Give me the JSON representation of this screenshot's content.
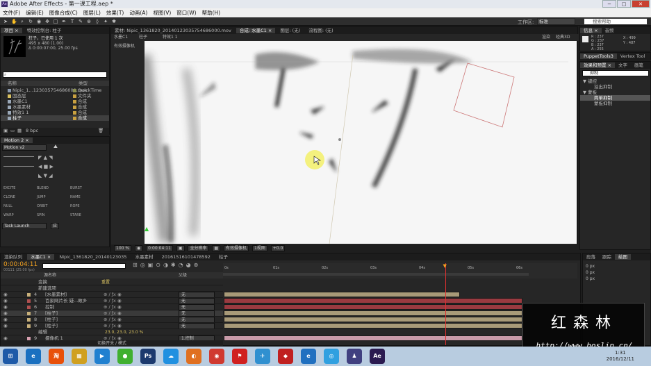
{
  "app": {
    "title": "Adobe After Effects - 第一课工程.aep *"
  },
  "window": {
    "minimize": "−",
    "maximize": "□",
    "close": "✕"
  },
  "menu": [
    "文件(F)",
    "编辑(E)",
    "图像合成(C)",
    "图层(L)",
    "效果(T)",
    "动画(A)",
    "视图(V)",
    "窗口(W)",
    "帮助(H)"
  ],
  "toolbar": {
    "workspace_label": "工作区:",
    "workspace_value": "标准",
    "search_placeholder": "搜索帮助"
  },
  "project": {
    "tabs": [
      "项目 ×",
      "特效控制台: 柱子"
    ],
    "preview_name": "柱子，已使用 1 次",
    "preview_size": "495 x 480 (1.00)",
    "preview_dur": "Δ 0:00:07:00, 25.00 fps",
    "col_name": "名称",
    "col_type": "类型",
    "items": [
      {
        "name": "Nipic_1...123035754686000.mov",
        "type": "QuickTime",
        "color": "#8a8f50"
      },
      {
        "name": "固态层",
        "type": "文件夹",
        "color": "#c8a040"
      },
      {
        "name": "水墨C1",
        "type": "合成",
        "color": "#c8a040"
      },
      {
        "name": "水墨素材",
        "type": "合成",
        "color": "#c8a040"
      },
      {
        "name": "特效1 1",
        "type": "合成",
        "color": "#c8a040"
      },
      {
        "name": "柱子",
        "type": "合成",
        "color": "#c8a040"
      }
    ],
    "bpc": "8 bpc"
  },
  "motion": {
    "tab": "Motion 2 ×",
    "preset": "Motion v2",
    "actions": [
      "EXCITE",
      "BLEND",
      "BURST",
      "CLONE",
      "JUMP",
      "NAME",
      "NULL",
      "ORBIT",
      "ROPE",
      "WARP",
      "SPIN",
      "STARE"
    ],
    "task": "Task Launch",
    "task_btn": "应"
  },
  "comp_tabs": [
    "素材: Nipic_1361820_20140123035754686000.mov",
    "合成: 水墨C1 ×",
    "图层: (无)",
    "流程图: (无)"
  ],
  "viewer": {
    "breadcrumb": [
      "水墨C1",
      "柱子",
      "特效1 1"
    ],
    "renderer": "渲染",
    "renderer_val": "经典3D",
    "camera": "有效摄像机",
    "zoom": "100 %",
    "timecode": "0:00:04:11",
    "res": "全分辨率",
    "view": "有效摄像机",
    "views": "1视图",
    "exposure": "+0.0"
  },
  "info": {
    "tabs": [
      "信息 ×",
      "音频"
    ],
    "r": "R : 237",
    "g": "G : 237",
    "b": "B : 237",
    "a": "A : 255",
    "x": "X : 499",
    "y": "Y : 487"
  },
  "right": {
    "tabs_top": [
      "PuppetTools3",
      "Vertex Tool"
    ],
    "tabs_fx": [
      "效果和预置 ×",
      "文字",
      "画笔"
    ],
    "search": "抑制",
    "tree": [
      {
        "label": "▼ 键控",
        "indent": 0
      },
      {
        "label": "溢出抑制",
        "indent": 2
      },
      {
        "label": "▼ 蒙板",
        "indent": 0
      },
      {
        "label": "简单抑制",
        "indent": 2,
        "sel": true
      },
      {
        "label": "蒙板抑制",
        "indent": 2
      }
    ],
    "tabs_bottom": [
      "段落",
      "跟踪",
      "绘图"
    ],
    "px1": "0 px",
    "px2": "0 px",
    "px3": "0 px"
  },
  "timeline": {
    "tabs": [
      "渲染队列",
      "水墨C1 ×",
      "Nipic_1361820_20140123035",
      "水墨素材",
      "20161516101478592",
      "柱子"
    ],
    "timecode": "0:00:04:11",
    "timecode_sub": "00111 (25.00 fps)",
    "col_source": "源名称",
    "col_parent": "父级",
    "ticks": [
      "0s",
      "01s",
      "02s",
      "03s",
      "04s",
      "05s",
      "06s"
    ],
    "layers": [
      {
        "num": "",
        "name": "变换",
        "sub": true,
        "parent": "",
        "color": ""
      },
      {
        "num": "",
        "name": "新建选项",
        "sub": true,
        "parent": "",
        "color": ""
      },
      {
        "num": "4",
        "name": "[水墨素材]",
        "parent": "无",
        "color": "#c8b07a"
      },
      {
        "num": "5",
        "name": "百家网片长 疑...故乡",
        "parent": "无",
        "color": "#b05050"
      },
      {
        "num": "6",
        "name": "控制",
        "parent": "无",
        "color": "#b05050"
      },
      {
        "num": "7",
        "name": "[柱子]",
        "parent": "无",
        "color": "#c8b07a",
        "sel": true
      },
      {
        "num": "8",
        "name": "[柱子]",
        "parent": "无",
        "color": "#c8b07a"
      },
      {
        "num": "9",
        "name": "[柱子]",
        "parent": "无",
        "color": "#c8b07a"
      },
      {
        "num": "",
        "name": "编辑",
        "sub": true,
        "parent": "",
        "color": ""
      },
      {
        "num": "9",
        "name": "摄像机 1",
        "parent": "1.控制",
        "color": "#d8a0b0"
      }
    ],
    "reset": "重置",
    "edit_val": "23.0, 23.0, 23.0 %",
    "switch_label": "切换开关 / 模式",
    "playhead_frac": 0.71
  },
  "watermark": {
    "name": "红森林",
    "url": "http://www.hoslin.cn/"
  },
  "taskbar": {
    "icons": [
      {
        "label": "⊞",
        "color": "#1e5aa8"
      },
      {
        "label": "e",
        "color": "#1a70c0"
      },
      {
        "label": "淘",
        "color": "#e8500a"
      },
      {
        "label": "▦",
        "color": "#d0a020"
      },
      {
        "label": "▶",
        "color": "#2080d0"
      },
      {
        "label": "●",
        "color": "#40b030"
      },
      {
        "label": "Ps",
        "color": "#1c3a6e"
      },
      {
        "label": "☁",
        "color": "#2090e0"
      },
      {
        "label": "◐",
        "color": "#e07020"
      },
      {
        "label": "◉",
        "color": "#d03a30"
      },
      {
        "label": "⚑",
        "color": "#d02020"
      },
      {
        "label": "✈",
        "color": "#3090d0"
      },
      {
        "label": "◆",
        "color": "#c02020"
      },
      {
        "label": "e",
        "color": "#2070c0"
      },
      {
        "label": "◎",
        "color": "#30a0e0"
      },
      {
        "label": "♟",
        "color": "#404080"
      },
      {
        "label": "Ae",
        "color": "#2a1a50"
      }
    ],
    "time": "1:31",
    "date": "2016/12/11"
  }
}
